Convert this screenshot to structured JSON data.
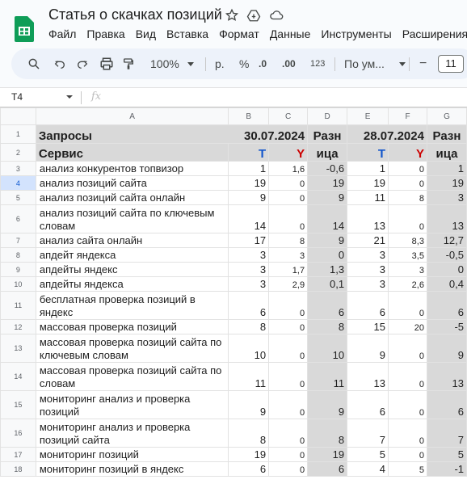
{
  "app": {
    "doc_title": "Статья о скачках позиций",
    "menu": [
      "Файл",
      "Правка",
      "Вид",
      "Вставка",
      "Формат",
      "Данные",
      "Инструменты",
      "Расширения"
    ]
  },
  "toolbar": {
    "zoom": "100%",
    "currency": "р.",
    "percent": "%",
    "dec_decrease": ".0",
    "dec_increase": ".00",
    "number_format": "123",
    "font": "По ум...",
    "font_size_minus": "−",
    "font_size": "11"
  },
  "formula_bar": {
    "cell_ref": "T4",
    "fx": "fx"
  },
  "columns": [
    "A",
    "B",
    "C",
    "D",
    "E",
    "F",
    "G"
  ],
  "header": {
    "row1_a": "Запросы",
    "row2_a": "Сервис",
    "date1": "30.07.2024",
    "date2": "28.07.2024",
    "diff1_top": "Разн",
    "diff1_bot": "ица",
    "diff2_top": "Разн",
    "diff2_bot": "ица",
    "t": "T",
    "y": "Y"
  },
  "rows": [
    {
      "num": "3",
      "a": "анализ конкурентов топвизор",
      "b": "1",
      "c": "1,6",
      "d": "-0,6",
      "e": "1",
      "f": "0",
      "g": "1"
    },
    {
      "num": "4",
      "a": "анализ позиций сайта",
      "b": "19",
      "c": "0",
      "d": "19",
      "e": "19",
      "f": "0",
      "g": "19"
    },
    {
      "num": "5",
      "a": "анализ позиций сайта онлайн",
      "b": "9",
      "c": "0",
      "d": "9",
      "e": "11",
      "f": "8",
      "g": "3"
    },
    {
      "num": "6",
      "a": "анализ позиций сайта по ключевым словам",
      "b": "14",
      "c": "0",
      "d": "14",
      "e": "13",
      "f": "0",
      "g": "13"
    },
    {
      "num": "7",
      "a": "анализ сайта онлайн",
      "b": "17",
      "c": "8",
      "d": "9",
      "e": "21",
      "f": "8,3",
      "g": "12,7"
    },
    {
      "num": "8",
      "a": "апдейт яндекса",
      "b": "3",
      "c": "3",
      "d": "0",
      "e": "3",
      "f": "3,5",
      "g": "-0,5"
    },
    {
      "num": "9",
      "a": "апдейты яндекс",
      "b": "3",
      "c": "1,7",
      "d": "1,3",
      "e": "3",
      "f": "3",
      "g": "0"
    },
    {
      "num": "10",
      "a": "апдейты яндекса",
      "b": "3",
      "c": "2,9",
      "d": "0,1",
      "e": "3",
      "f": "2,6",
      "g": "0,4"
    },
    {
      "num": "11",
      "a": "бесплатная проверка позиций в яндекс",
      "b": "6",
      "c": "0",
      "d": "6",
      "e": "6",
      "f": "0",
      "g": "6"
    },
    {
      "num": "12",
      "a": "массовая проверка позиций",
      "b": "8",
      "c": "0",
      "d": "8",
      "e": "15",
      "f": "20",
      "g": "-5"
    },
    {
      "num": "13",
      "a": "массовая проверка позиций сайта по ключевым словам",
      "b": "10",
      "c": "0",
      "d": "10",
      "e": "9",
      "f": "0",
      "g": "9"
    },
    {
      "num": "14",
      "a": "массовая проверка позиций сайта по словам",
      "b": "11",
      "c": "0",
      "d": "11",
      "e": "13",
      "f": "0",
      "g": "13"
    },
    {
      "num": "15",
      "a": "мониторинг анализ и проверка позиций",
      "b": "9",
      "c": "0",
      "d": "9",
      "e": "6",
      "f": "0",
      "g": "6"
    },
    {
      "num": "16",
      "a": "мониторинг анализ и проверка позиций сайта",
      "b": "8",
      "c": "0",
      "d": "8",
      "e": "7",
      "f": "0",
      "g": "7"
    },
    {
      "num": "17",
      "a": "мониторинг позиций",
      "b": "19",
      "c": "0",
      "d": "19",
      "e": "5",
      "f": "0",
      "g": "5"
    },
    {
      "num": "18",
      "a": "мониторинг позиций в яндекс",
      "b": "6",
      "c": "0",
      "d": "6",
      "e": "4",
      "f": "5",
      "g": "-1"
    }
  ],
  "colors": {
    "accent_blue": "#1155cc",
    "accent_red": "#cc0000",
    "diff_column_gray": "#d9d9d9",
    "sheets_green": "#0f9d58"
  }
}
